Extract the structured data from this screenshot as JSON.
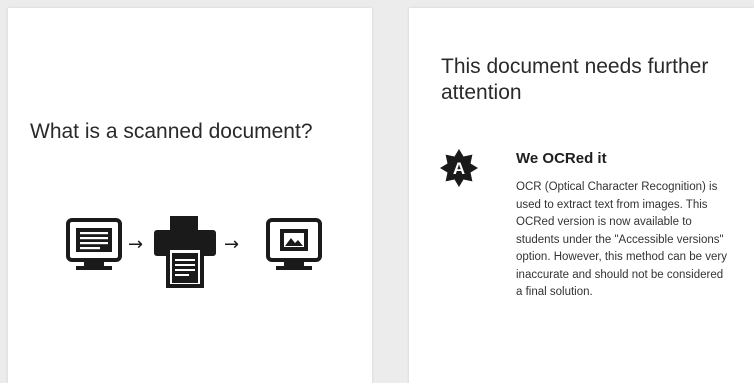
{
  "left_card": {
    "title": "What is a scanned document?",
    "flow_icons": [
      "monitor-document-icon",
      "arrow-right-icon",
      "printer-icon",
      "arrow-right-icon",
      "monitor-image-icon"
    ],
    "arrow_glyph": "→"
  },
  "right_card": {
    "title": "This document needs further attention",
    "badge_letter": "A",
    "badge_icon": "accessibility-score-badge-icon",
    "heading": "We OCRed it",
    "body": "OCR (Optical Character Recognition) is used to extract text from images. This OCRed version is now available to students under the \"Accessible versions\" option. However, this method can be very inaccurate and should not be considered a final solution."
  },
  "colors": {
    "background": "#ececec",
    "card": "#ffffff",
    "icon": "#1a1a1a"
  }
}
